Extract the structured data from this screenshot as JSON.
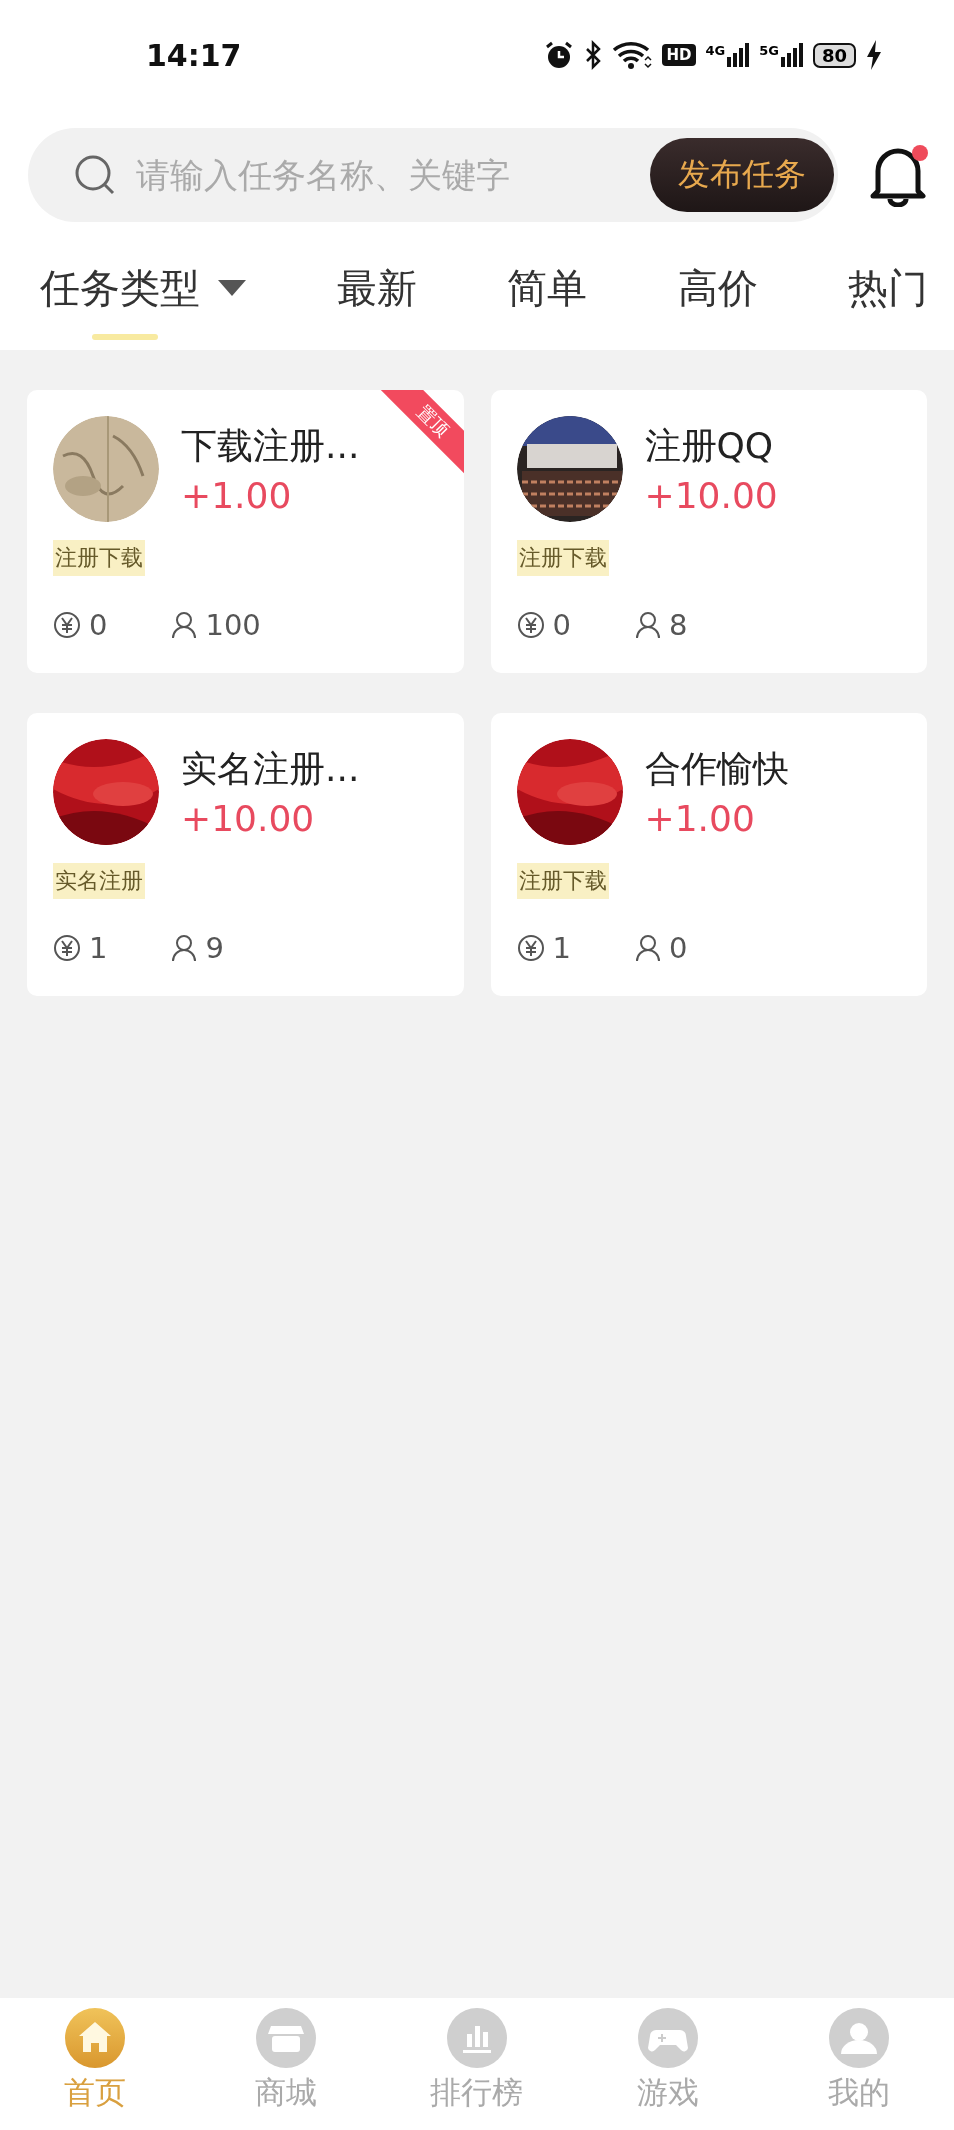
{
  "status_bar": {
    "time": "14:17",
    "hd_label": "HD",
    "networks": [
      "4G",
      "5G"
    ],
    "battery": "80",
    "charging": true
  },
  "header": {
    "search": {
      "placeholder": "请输入任务名称、关键字"
    },
    "publish_button": "发布任务",
    "notification_dot": true
  },
  "tabs": [
    {
      "label": "任务类型",
      "selected": true,
      "dropdown": true
    },
    {
      "label": "最新",
      "selected": false,
      "dropdown": false
    },
    {
      "label": "简单",
      "selected": false,
      "dropdown": false
    },
    {
      "label": "高价",
      "selected": false,
      "dropdown": false
    },
    {
      "label": "热门",
      "selected": false,
      "dropdown": false
    }
  ],
  "tasks": [
    {
      "title": "下载注册...",
      "reward": "+1.00",
      "tag": "注册下载",
      "deposit": "0",
      "participants": "100",
      "pinned": true,
      "pin_label": "置顶"
    },
    {
      "title": "注册QQ",
      "reward": "+10.00",
      "tag": "注册下载",
      "deposit": "0",
      "participants": "8",
      "pinned": false
    },
    {
      "title": "实名注册...",
      "reward": "+10.00",
      "tag": "实名注册",
      "deposit": "1",
      "participants": "9",
      "pinned": false
    },
    {
      "title": "合作愉快",
      "reward": "+1.00",
      "tag": "注册下载",
      "deposit": "1",
      "participants": "0",
      "pinned": false
    }
  ],
  "bottom_nav": [
    {
      "label": "首页",
      "selected": true
    },
    {
      "label": "商城",
      "selected": false
    },
    {
      "label": "排行榜",
      "selected": false
    },
    {
      "label": "游戏",
      "selected": false
    },
    {
      "label": "我的",
      "selected": false
    }
  ]
}
